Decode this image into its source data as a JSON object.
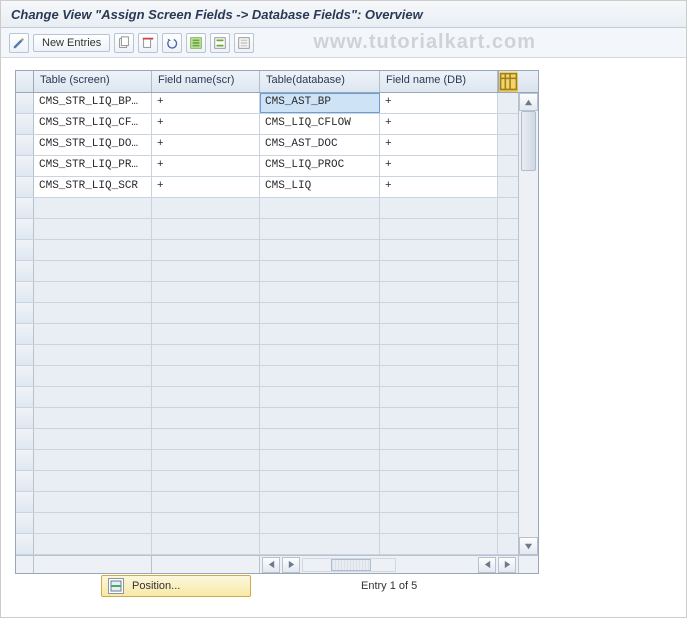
{
  "title": "Change View \"Assign Screen Fields -> Database Fields\": Overview",
  "watermark": "www.tutorialkart.com",
  "toolbar": {
    "new_entries": "New Entries"
  },
  "columns": {
    "c1": "Table (screen)",
    "c2": "Field name(scr)",
    "c3": "Table(database)",
    "c4": "Field name (DB)"
  },
  "rows": [
    {
      "c1": "CMS_STR_LIQ_BP…",
      "c2": "+",
      "c3": "CMS_AST_BP",
      "c4": "+",
      "selected": true
    },
    {
      "c1": "CMS_STR_LIQ_CF…",
      "c2": "+",
      "c3": "CMS_LIQ_CFLOW",
      "c4": "+"
    },
    {
      "c1": "CMS_STR_LIQ_DO…",
      "c2": "+",
      "c3": "CMS_AST_DOC",
      "c4": "+"
    },
    {
      "c1": "CMS_STR_LIQ_PR…",
      "c2": "+",
      "c3": "CMS_LIQ_PROC",
      "c4": "+"
    },
    {
      "c1": "CMS_STR_LIQ_SCR",
      "c2": "+",
      "c3": "CMS_LIQ",
      "c4": "+"
    }
  ],
  "empty_row_count": 17,
  "footer": {
    "position_label": "Position...",
    "entry_text": "Entry 1 of 5"
  }
}
